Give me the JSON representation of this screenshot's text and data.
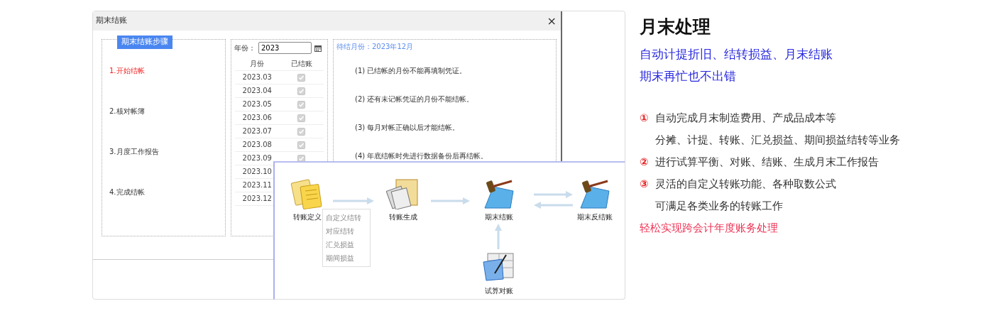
{
  "dialog": {
    "title": "期末结账",
    "close": "×",
    "legend": "期末结账步骤",
    "steps": [
      {
        "label": "1.开始结帐",
        "selected": true
      },
      {
        "label": "2.核对帐簿",
        "selected": false
      },
      {
        "label": "3.月度工作报告",
        "selected": false
      },
      {
        "label": "4.完成结帐",
        "selected": false
      }
    ],
    "year_label": "年份：",
    "year": "2023",
    "columns": [
      "月份",
      "已结账"
    ],
    "rows": [
      {
        "month": "2023.03",
        "checked": true
      },
      {
        "month": "2023.04",
        "checked": true
      },
      {
        "month": "2023.05",
        "checked": true
      },
      {
        "month": "2023.06",
        "checked": true
      },
      {
        "month": "2023.07",
        "checked": true
      },
      {
        "month": "2023.08",
        "checked": true
      },
      {
        "month": "2023.09",
        "checked": true
      },
      {
        "month": "2023.10"
      },
      {
        "month": "2023.11"
      },
      {
        "month": "2023.12"
      }
    ],
    "pending": "待结月份：2023年12月",
    "notes": [
      "(1) 已结帐的月份不能再填制凭证。",
      "(2) 还有未记帐凭证的月份不能结帐。",
      "(3) 每月对帐正确以后才能结帐。",
      "(4) 年底结帐时先进行数据备份后再结帐。"
    ]
  },
  "flow": {
    "nodes": [
      {
        "label": "转账定义",
        "kind": "notes"
      },
      {
        "label": "转账生成",
        "kind": "documents"
      },
      {
        "label": "期末结账",
        "kind": "gavel"
      },
      {
        "label": "期末反结账",
        "kind": "gavel"
      },
      {
        "label": "试算对账",
        "kind": "ledger"
      }
    ],
    "menu": [
      "自定义结转",
      "对应结转",
      "汇兑损益",
      "期间损益"
    ]
  },
  "info": {
    "title": "月末处理",
    "subtitle": [
      "自动计提折旧、结转损益、月末结账",
      "期末再忙也不出错"
    ],
    "items": [
      {
        "marker": "①",
        "lines": [
          "自动完成月末制造费用、产成品成本等",
          "分摊、计提、转账、汇兑损益、期间损益结转等业务"
        ]
      },
      {
        "marker": "②",
        "lines": [
          "进行试算平衡、对账、结账、生成月末工作报告"
        ]
      },
      {
        "marker": "③",
        "lines": [
          "灵活的自定义转账功能、各种取数公式",
          "可满足各类业务的转账工作"
        ]
      }
    ],
    "footer": "轻松实现跨会计年度账务处理"
  }
}
